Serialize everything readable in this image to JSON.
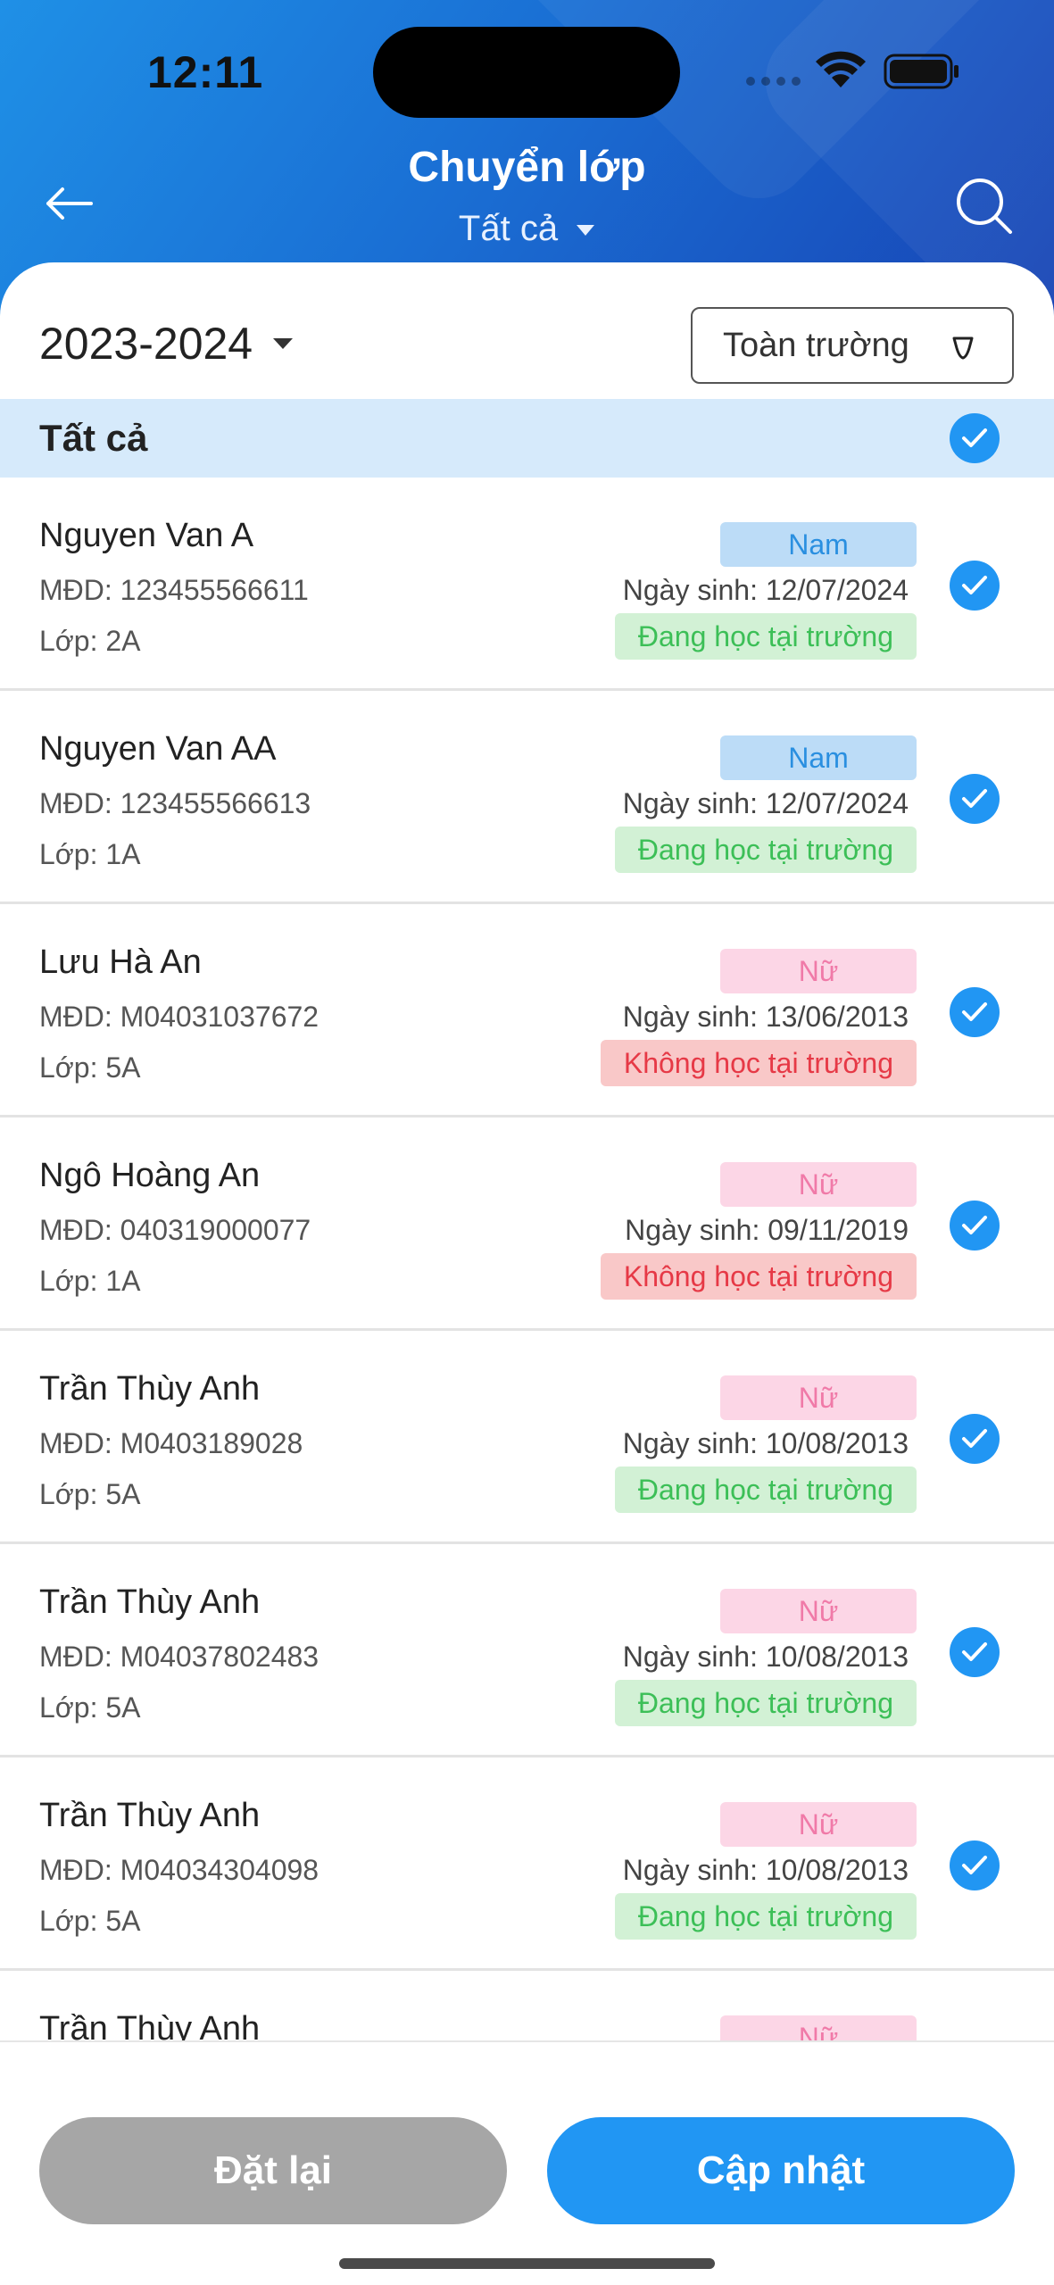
{
  "status_bar": {
    "time": "12:11"
  },
  "header": {
    "title": "Chuyển lớp",
    "filter_label": "Tất cả"
  },
  "toolbar": {
    "school_year": "2023-2024",
    "scope_filter": "Toàn trường"
  },
  "select_all": {
    "label": "Tất cả",
    "checked": true
  },
  "students": [
    {
      "name": "Nguyen Van A",
      "code": "MĐD: 123455566611",
      "class": "Lớp: 2A",
      "gender": "Nam",
      "dob": "Ngày sinh: 12/07/2024",
      "status": "Đang học tại trường",
      "checked": true
    },
    {
      "name": "Nguyen Van AA",
      "code": "MĐD: 123455566613",
      "class": "Lớp: 1A",
      "gender": "Nam",
      "dob": "Ngày sinh: 12/07/2024",
      "status": "Đang học tại trường",
      "checked": true
    },
    {
      "name": "Lưu Hà An",
      "code": "MĐD: M04031037672",
      "class": "Lớp: 5A",
      "gender": "Nữ",
      "dob": "Ngày sinh: 13/06/2013",
      "status": "Không học tại trường",
      "checked": true
    },
    {
      "name": "Ngô Hoàng An",
      "code": "MĐD: 040319000077",
      "class": "Lớp: 1A",
      "gender": "Nữ",
      "dob": "Ngày sinh: 09/11/2019",
      "status": "Không học tại trường",
      "checked": true
    },
    {
      "name": "Trần Thùy Anh",
      "code": "MĐD: M0403189028",
      "class": "Lớp: 5A",
      "gender": "Nữ",
      "dob": "Ngày sinh: 10/08/2013",
      "status": "Đang học tại trường",
      "checked": true
    },
    {
      "name": "Trần Thùy Anh",
      "code": "MĐD: M04037802483",
      "class": "Lớp: 5A",
      "gender": "Nữ",
      "dob": "Ngày sinh: 10/08/2013",
      "status": "Đang học tại trường",
      "checked": true
    },
    {
      "name": "Trần Thùy Anh",
      "code": "MĐD: M04034304098",
      "class": "Lớp: 5A",
      "gender": "Nữ",
      "dob": "Ngày sinh: 10/08/2013",
      "status": "Đang học tại trường",
      "checked": true
    },
    {
      "name": "Trần Thùy Anh",
      "gender": "Nữ"
    }
  ],
  "footer": {
    "reset_label": "Đặt lại",
    "update_label": "Cập nhật"
  },
  "colors": {
    "accent": "#2196f3",
    "header_gradient_start": "#1f90e6",
    "header_gradient_end": "#1844b5"
  }
}
